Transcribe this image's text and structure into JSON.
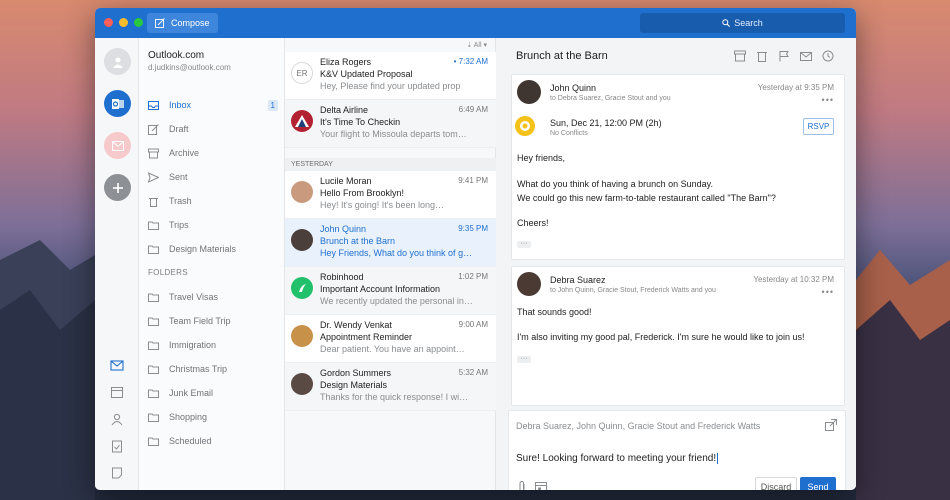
{
  "window": {
    "compose_label": "Compose",
    "search_label": "Search"
  },
  "account": {
    "name": "Outlook.com",
    "email": "d.judkins@outlook.com"
  },
  "folders": {
    "inbox": "Inbox",
    "inbox_count": "1",
    "draft": "Draft",
    "archive": "Archive",
    "sent": "Sent",
    "trash": "Trash",
    "trips": "Trips",
    "design": "Design Materials",
    "section": "FOLDERS",
    "custom": [
      "Travel Visas",
      "Team Field Trip",
      "Immigration",
      "Christmas Trip",
      "Junk Email",
      "Shopping",
      "Scheduled"
    ]
  },
  "list": {
    "filter": "All",
    "yesterday": "YESTERDAY",
    "messages": [
      {
        "initials": "ER",
        "sender": "Eliza Rogers",
        "time": "• 7:32 AM",
        "subject": "K&V Updated Proposal",
        "preview": "Hey, Please find your updated prop"
      },
      {
        "sender": "Delta Airline",
        "time": "6:49 AM",
        "subject": "It's Time To Checkin",
        "preview": "Your flight to Missoula departs tom…"
      },
      {
        "sender": "Lucile Moran",
        "time": "9:41 PM",
        "subject": "Hello From Brooklyn!",
        "preview": "Hey! It's going! It's been long…"
      },
      {
        "sender": "John Quinn",
        "time": "9:35 PM",
        "subject": "Brunch at the Barn",
        "preview": "Hey Friends, What do you think of g…"
      },
      {
        "sender": "Robinhood",
        "time": "1:02 PM",
        "subject": "Important Account Information",
        "preview": "We recently updated the personal in…"
      },
      {
        "sender": "Dr. Wendy Venkat",
        "time": "9:00 AM",
        "subject": "Appointment Reminder",
        "preview": "Dear patient. You have an appoint…"
      },
      {
        "sender": "Gordon Summers",
        "time": "5:32 AM",
        "subject": "Design Materials",
        "preview": "Thanks for the quick response! I wi…"
      }
    ]
  },
  "reader": {
    "subject": "Brunch at the Barn",
    "first": {
      "from": "John Quinn",
      "to": "to Debra Suarez, Gracie Stout and you",
      "when": "Yesterday at 9:35 PM",
      "event_time": "Sun, Dec 21, 12:00 PM (2h)",
      "event_sub": "No Conflicts",
      "rsvp": "RSVP",
      "lines": [
        "Hey friends,",
        "What do you think of having a brunch on Sunday.",
        "We could go this new farm-to-table restaurant called \"The Barn\"?",
        "Cheers!"
      ]
    },
    "second": {
      "from": "Debra Suarez",
      "to": "to John Quinn, Gracie Stout, Frederick Watts and you",
      "when": "Yesterday at 10:32 PM",
      "lines": [
        "That sounds good!",
        "I'm also inviting my good pal, Frederick. I'm sure he would like to join us!"
      ]
    },
    "reply": {
      "to": "Debra Suarez, John Quinn, Gracie Stout and Frederick Watts",
      "text": "Sure! Looking forward to meeting your friend!",
      "discard": "Discard",
      "send": "Send"
    }
  }
}
